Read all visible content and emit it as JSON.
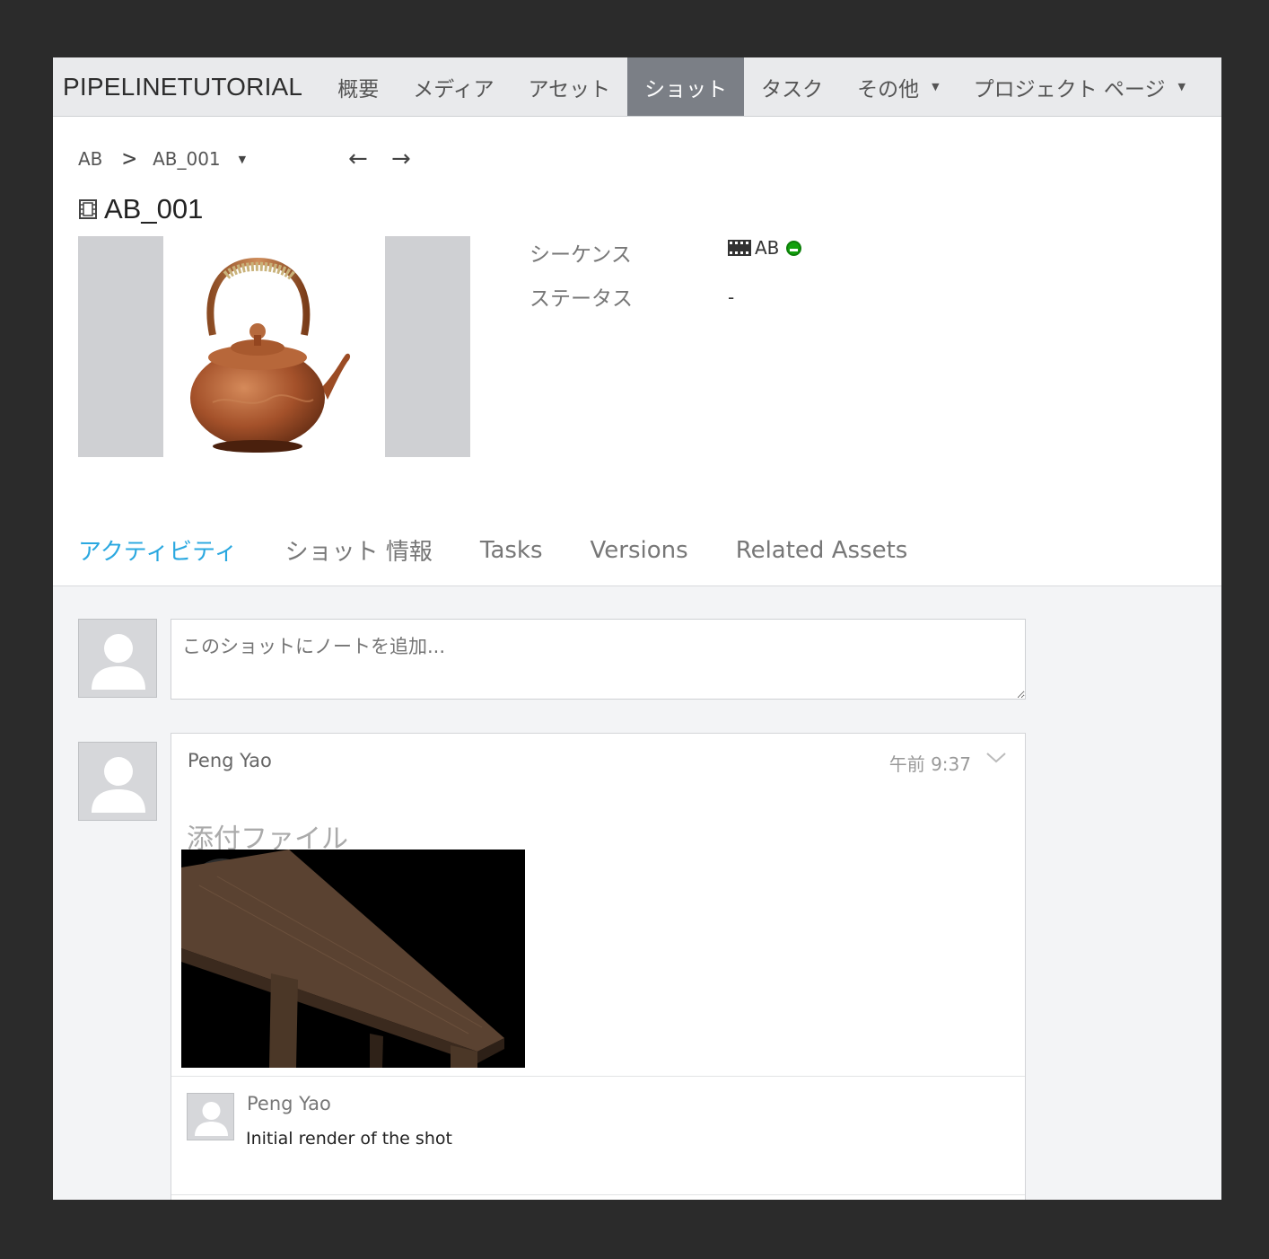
{
  "nav": {
    "brand": "PIPELINETUTORIAL",
    "items": [
      {
        "label": "概要"
      },
      {
        "label": "メディア"
      },
      {
        "label": "アセット"
      },
      {
        "label": "ショット"
      },
      {
        "label": "タスク"
      },
      {
        "label": "その他"
      },
      {
        "label": "プロジェクト ページ"
      }
    ],
    "active_index": 3
  },
  "breadcrumb": {
    "parent": "AB",
    "separator": ">",
    "current": "AB_001"
  },
  "entity": {
    "title": "AB_001",
    "sequence_label": "シーケンス",
    "sequence_value": "AB",
    "status_label": "ステータス",
    "status_value": "-"
  },
  "tabs": [
    {
      "label": "アクティビティ"
    },
    {
      "label": "ショット 情報"
    },
    {
      "label": "Tasks"
    },
    {
      "label": "Versions"
    },
    {
      "label": "Related Assets"
    }
  ],
  "note_input": {
    "placeholder": "このショットにノートを追加..."
  },
  "activity": {
    "author": "Peng Yao",
    "time": "午前 9:37",
    "attachments_label": "添付ファイル",
    "reply": {
      "author": "Peng Yao",
      "text": "Initial render of the shot"
    }
  },
  "colors": {
    "active_tab": "#2aa8e0",
    "active_nav": "#7b7f86",
    "status_green": "#13a10e"
  }
}
